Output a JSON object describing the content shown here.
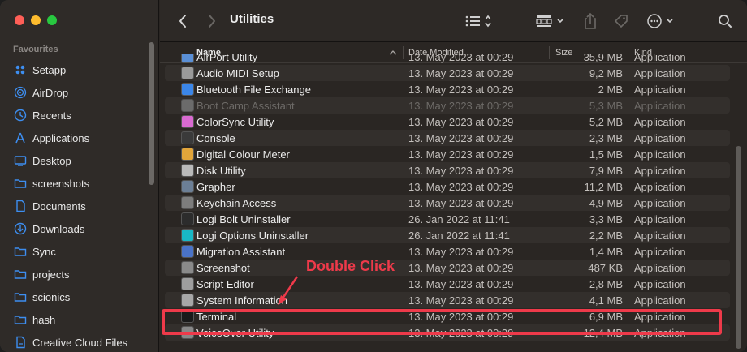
{
  "window": {
    "title": "Utilities"
  },
  "sidebar": {
    "section_label": "Favourites",
    "items": [
      {
        "label": "Setapp",
        "icon": "setapp-icon"
      },
      {
        "label": "AirDrop",
        "icon": "airdrop-icon"
      },
      {
        "label": "Recents",
        "icon": "clock-icon"
      },
      {
        "label": "Applications",
        "icon": "applications-icon"
      },
      {
        "label": "Desktop",
        "icon": "desktop-icon"
      },
      {
        "label": "screenshots",
        "icon": "folder-icon"
      },
      {
        "label": "Documents",
        "icon": "document-icon"
      },
      {
        "label": "Downloads",
        "icon": "download-icon"
      },
      {
        "label": "Sync",
        "icon": "folder-icon"
      },
      {
        "label": "projects",
        "icon": "folder-icon"
      },
      {
        "label": "scionics",
        "icon": "folder-icon"
      },
      {
        "label": "hash",
        "icon": "folder-icon"
      },
      {
        "label": "Creative Cloud Files",
        "icon": "cloud-file-icon"
      }
    ]
  },
  "columns": {
    "name": "Name",
    "date": "Date Modified",
    "size": "Size",
    "kind": "Kind"
  },
  "rows": [
    {
      "name": "AirPort Utility",
      "date": "13. May 2023 at 00:29",
      "size": "35,9 MB",
      "kind": "Application",
      "color": "#5a8fd6"
    },
    {
      "name": "Audio MIDI Setup",
      "date": "13. May 2023 at 00:29",
      "size": "9,2 MB",
      "kind": "Application",
      "color": "#9a9a9a"
    },
    {
      "name": "Bluetooth File Exchange",
      "date": "13. May 2023 at 00:29",
      "size": "2 MB",
      "kind": "Application",
      "color": "#3b86e8"
    },
    {
      "name": "Boot Camp Assistant",
      "date": "13. May 2023 at 00:29",
      "size": "5,3 MB",
      "kind": "Application",
      "color": "#6b6b6b"
    },
    {
      "name": "ColorSync Utility",
      "date": "13. May 2023 at 00:29",
      "size": "5,2 MB",
      "kind": "Application",
      "color": "#d96ad1"
    },
    {
      "name": "Console",
      "date": "13. May 2023 at 00:29",
      "size": "2,3 MB",
      "kind": "Application",
      "color": "#3a3a3a"
    },
    {
      "name": "Digital Colour Meter",
      "date": "13. May 2023 at 00:29",
      "size": "1,5 MB",
      "kind": "Application",
      "color": "#e2a53a"
    },
    {
      "name": "Disk Utility",
      "date": "13. May 2023 at 00:29",
      "size": "7,9 MB",
      "kind": "Application",
      "color": "#b9b9b9"
    },
    {
      "name": "Grapher",
      "date": "13. May 2023 at 00:29",
      "size": "11,2 MB",
      "kind": "Application",
      "color": "#6c7f96"
    },
    {
      "name": "Keychain Access",
      "date": "13. May 2023 at 00:29",
      "size": "4,9 MB",
      "kind": "Application",
      "color": "#7d7d7d"
    },
    {
      "name": "Logi Bolt Uninstaller",
      "date": "26. Jan 2022 at 11:41",
      "size": "3,3 MB",
      "kind": "Application",
      "color": "#2c2c2c"
    },
    {
      "name": "Logi Options Uninstaller",
      "date": "26. Jan 2022 at 11:41",
      "size": "2,2 MB",
      "kind": "Application",
      "color": "#19b8c6"
    },
    {
      "name": "Migration Assistant",
      "date": "13. May 2023 at 00:29",
      "size": "1,4 MB",
      "kind": "Application",
      "color": "#4a73c8"
    },
    {
      "name": "Screenshot",
      "date": "13. May 2023 at 00:29",
      "size": "487 KB",
      "kind": "Application",
      "color": "#8a8a8a"
    },
    {
      "name": "Script Editor",
      "date": "13. May 2023 at 00:29",
      "size": "2,8 MB",
      "kind": "Application",
      "color": "#9e9e9e"
    },
    {
      "name": "System Information",
      "date": "13. May 2023 at 00:29",
      "size": "4,1 MB",
      "kind": "Application",
      "color": "#a7a7a7"
    },
    {
      "name": "Terminal",
      "date": "13. May 2023 at 00:29",
      "size": "6,9 MB",
      "kind": "Application",
      "color": "#1a1a1a"
    },
    {
      "name": "VoiceOver Utility",
      "date": "13. May 2023 at 00:29",
      "size": "12,4 MB",
      "kind": "Application",
      "color": "#888888"
    }
  ],
  "annotation": {
    "label": "Double Click",
    "color": "#ee3a4a"
  }
}
